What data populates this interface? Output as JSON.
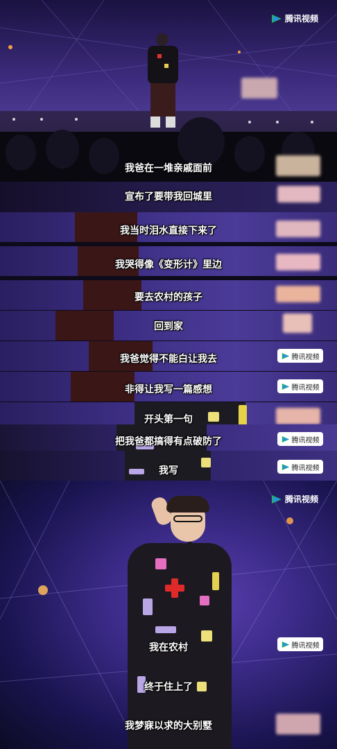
{
  "brand": {
    "name": "腾讯视频"
  },
  "colors": {
    "accent_green": "#1db954",
    "accent_blue": "#2d8cf0",
    "stage_purple": "#4b3a92"
  },
  "subtitles": [
    "我爸在一堆亲戚面前",
    "宣布了要带我回城里",
    "我当时泪水直接下来了",
    "我哭得像《变形计》里边",
    "要去农村的孩子",
    "回到家",
    "我爸觉得不能白让我去",
    "非得让我写一篇感想",
    "开头第一句",
    "把我爸都搞得有点破防了",
    "我写"
  ],
  "bottom_subtitles": [
    "我在农村",
    "终于住上了",
    "我梦寐以求的大别墅"
  ],
  "badge_label": "腾讯视频"
}
